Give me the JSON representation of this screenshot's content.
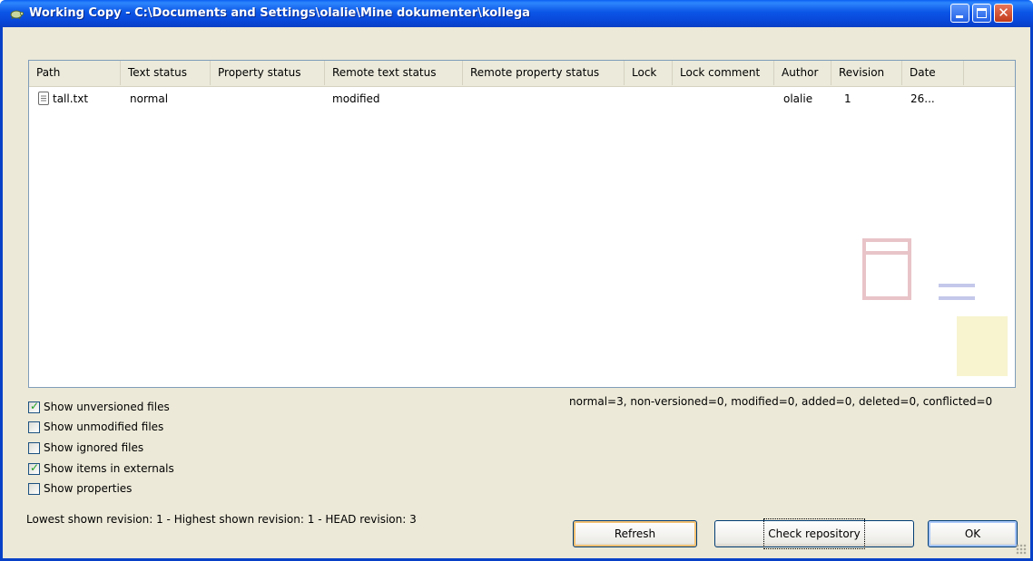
{
  "window": {
    "title": "Working Copy - C:\\Documents and Settings\\olalie\\Mine dokumenter\\kollega"
  },
  "list": {
    "columns": [
      "Path",
      "Text status",
      "Property status",
      "Remote text status",
      "Remote property status",
      "Lock",
      "Lock comment",
      "Author",
      "Revision",
      "Date"
    ],
    "rows": [
      {
        "path": "tall.txt",
        "text_status": "normal",
        "property_status": "",
        "remote_text_status": "modified",
        "remote_property_status": "",
        "lock": "",
        "lock_comment": "",
        "author": "olalie",
        "revision": "1",
        "date": "26..."
      }
    ]
  },
  "options": [
    {
      "label": "Show unversioned files",
      "checked": true
    },
    {
      "label": "Show unmodified files",
      "checked": false
    },
    {
      "label": "Show ignored files",
      "checked": false
    },
    {
      "label": "Show items in externals",
      "checked": true
    },
    {
      "label": "Show properties",
      "checked": false
    }
  ],
  "summary": "normal=3, non-versioned=0, modified=0, added=0, deleted=0, conflicted=0",
  "revision_info": "Lowest shown revision: 1 - Highest shown revision: 1 - HEAD revision: 3",
  "buttons": {
    "refresh": "Refresh",
    "check": "Check repository",
    "ok": "OK"
  },
  "icons": {
    "app": "tortoise-icon",
    "file": "text-file-icon"
  }
}
